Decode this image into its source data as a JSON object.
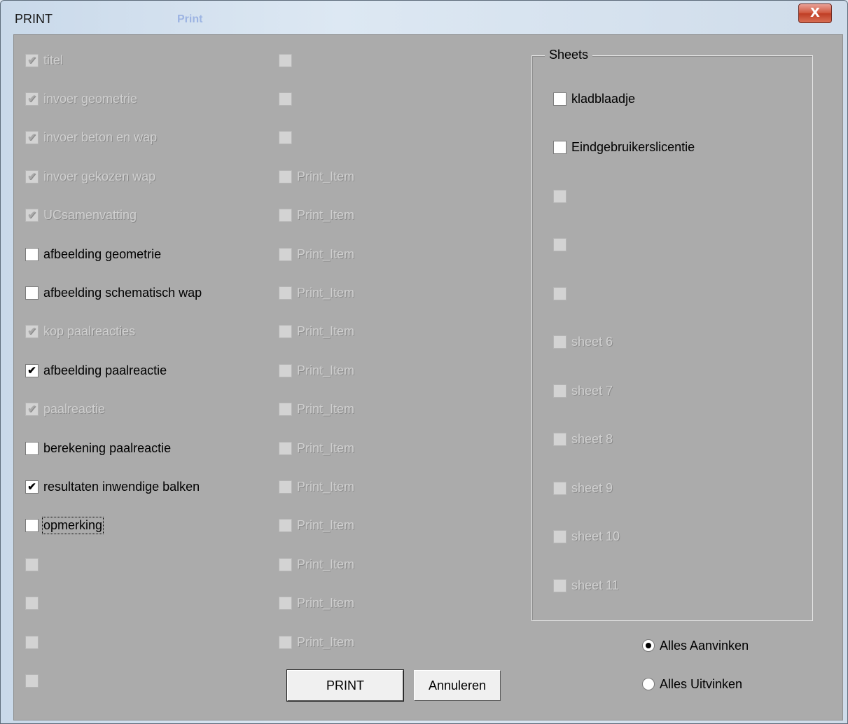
{
  "window": {
    "title": "PRINT",
    "background_title": "Print",
    "close_symbol": "X"
  },
  "colors": {
    "client_bg": "#ababab",
    "disabled_text": "#d0d0d0",
    "close_button": "#c74a32"
  },
  "left_column": [
    {
      "label": "titel",
      "checked": true,
      "enabled": false
    },
    {
      "label": "invoer geometrie",
      "checked": true,
      "enabled": false
    },
    {
      "label": "invoer beton en wap",
      "checked": true,
      "enabled": false
    },
    {
      "label": "invoer gekozen wap",
      "checked": true,
      "enabled": false
    },
    {
      "label": "UCsamenvatting",
      "checked": true,
      "enabled": false
    },
    {
      "label": "afbeelding geometrie",
      "checked": false,
      "enabled": true
    },
    {
      "label": "afbeelding schematisch wap",
      "checked": false,
      "enabled": true
    },
    {
      "label": "kop paalreacties",
      "checked": true,
      "enabled": false
    },
    {
      "label": "afbeelding paalreactie",
      "checked": true,
      "enabled": true
    },
    {
      "label": "paalreactie",
      "checked": true,
      "enabled": false
    },
    {
      "label": "berekening paalreactie",
      "checked": false,
      "enabled": true
    },
    {
      "label": "resultaten inwendige balken",
      "checked": true,
      "enabled": true
    },
    {
      "label": "opmerking",
      "checked": false,
      "enabled": true,
      "focused": true
    },
    {
      "label": "",
      "checked": false,
      "enabled": false
    },
    {
      "label": "",
      "checked": false,
      "enabled": false
    },
    {
      "label": "",
      "checked": false,
      "enabled": false
    },
    {
      "label": "",
      "checked": false,
      "enabled": false
    }
  ],
  "middle_column": [
    {
      "label": "",
      "checked": false,
      "enabled": false
    },
    {
      "label": "",
      "checked": false,
      "enabled": false
    },
    {
      "label": "",
      "checked": false,
      "enabled": false
    },
    {
      "label": "Print_Item",
      "checked": false,
      "enabled": false
    },
    {
      "label": "Print_Item",
      "checked": false,
      "enabled": false
    },
    {
      "label": "Print_Item",
      "checked": false,
      "enabled": false
    },
    {
      "label": "Print_Item",
      "checked": false,
      "enabled": false
    },
    {
      "label": "Print_Item",
      "checked": false,
      "enabled": false
    },
    {
      "label": "Print_Item",
      "checked": false,
      "enabled": false
    },
    {
      "label": "Print_Item",
      "checked": false,
      "enabled": false
    },
    {
      "label": "Print_Item",
      "checked": false,
      "enabled": false
    },
    {
      "label": "Print_Item",
      "checked": false,
      "enabled": false
    },
    {
      "label": "Print_Item",
      "checked": false,
      "enabled": false
    },
    {
      "label": "Print_Item",
      "checked": false,
      "enabled": false
    },
    {
      "label": "Print_Item",
      "checked": false,
      "enabled": false
    },
    {
      "label": "Print_Item",
      "checked": false,
      "enabled": false
    }
  ],
  "sheets": {
    "title": "Sheets",
    "items": [
      {
        "label": "kladblaadje",
        "checked": false,
        "enabled": true
      },
      {
        "label": "Eindgebruikerslicentie",
        "checked": false,
        "enabled": true
      },
      {
        "label": "",
        "checked": false,
        "enabled": false
      },
      {
        "label": "",
        "checked": false,
        "enabled": false
      },
      {
        "label": "",
        "checked": false,
        "enabled": false
      },
      {
        "label": "sheet 6",
        "checked": false,
        "enabled": false
      },
      {
        "label": "sheet 7",
        "checked": false,
        "enabled": false
      },
      {
        "label": "sheet 8",
        "checked": false,
        "enabled": false
      },
      {
        "label": "sheet 9",
        "checked": false,
        "enabled": false
      },
      {
        "label": "sheet 10",
        "checked": false,
        "enabled": false
      },
      {
        "label": "sheet 11",
        "checked": false,
        "enabled": false
      }
    ]
  },
  "buttons": {
    "print_label": "PRINT",
    "cancel_label": "Annuleren"
  },
  "options": {
    "check_all_label": "Alles Aanvinken",
    "uncheck_all_label": "Alles Uitvinken",
    "selected": "check_all"
  }
}
